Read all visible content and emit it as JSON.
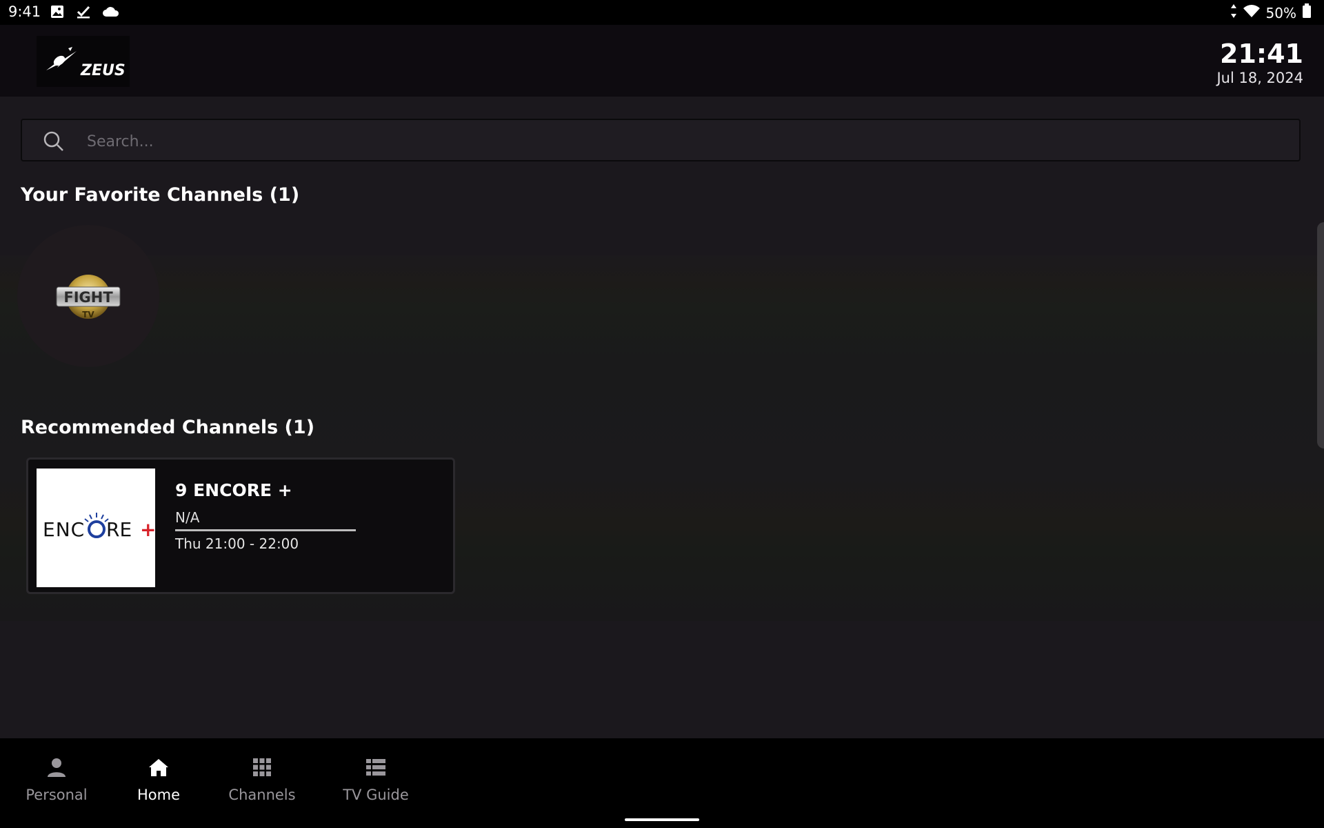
{
  "status_bar": {
    "time": "9:41",
    "left_icons": [
      "image-icon",
      "checkmark-download-icon",
      "cloud-icon"
    ],
    "battery_percent": "50%"
  },
  "header": {
    "logo_text": "ZEUS",
    "clock_time": "21:41",
    "clock_date": "Jul 18, 2024"
  },
  "search": {
    "placeholder": "Search...",
    "value": ""
  },
  "favorites": {
    "title": "Your Favorite Channels (1)",
    "items": [
      {
        "logo_text": "FIGHT",
        "logo_sub": "TV"
      }
    ]
  },
  "recommended": {
    "title": "Recommended Channels (1)",
    "items": [
      {
        "logo_text": "ENCORE+",
        "name": "9 ENCORE +",
        "program": "N/A",
        "schedule": "Thu 21:00 - 22:00"
      }
    ]
  },
  "bottom_nav": {
    "items": [
      {
        "label": "Personal",
        "icon": "person-icon",
        "active": false
      },
      {
        "label": "Home",
        "icon": "home-icon",
        "active": true
      },
      {
        "label": "Channels",
        "icon": "grid-icon",
        "active": false
      },
      {
        "label": "TV Guide",
        "icon": "list-icon",
        "active": false
      }
    ]
  },
  "colors": {
    "background": "#1b181d",
    "header": "#0e0b10",
    "nav": "#000000",
    "accent_red": "#d8232a",
    "accent_blue": "#1e3f9e"
  }
}
